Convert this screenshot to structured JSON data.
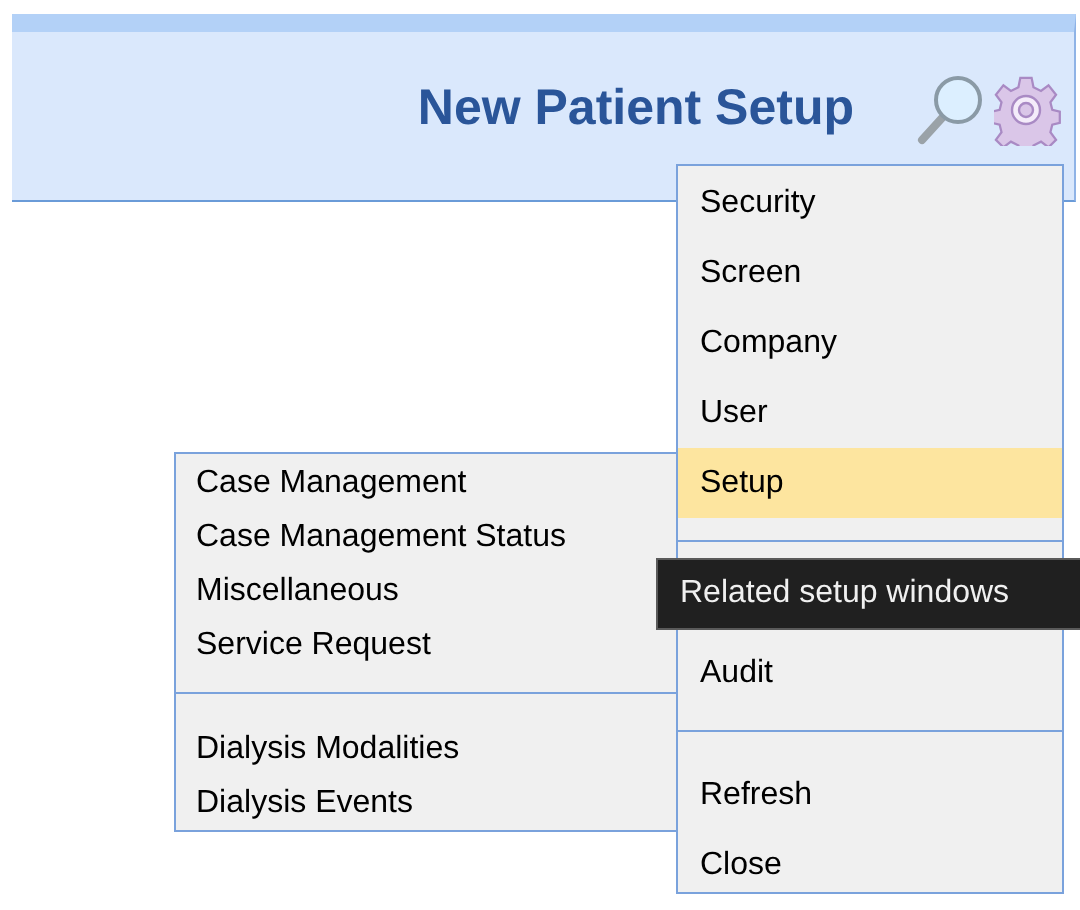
{
  "header": {
    "title": "New Patient Setup"
  },
  "menu": {
    "items": [
      {
        "kind": "item",
        "label": "Security",
        "selected": false
      },
      {
        "kind": "item",
        "label": "Screen",
        "selected": false
      },
      {
        "kind": "item",
        "label": "Company",
        "selected": false
      },
      {
        "kind": "item",
        "label": "User",
        "selected": false
      },
      {
        "kind": "item",
        "label": "Setup",
        "selected": true
      },
      {
        "kind": "separator"
      },
      {
        "kind": "tooltip",
        "text": "Related setup windows"
      },
      {
        "kind": "item",
        "label": "Audit",
        "selected": false
      },
      {
        "kind": "separator"
      },
      {
        "kind": "item",
        "label": "Refresh",
        "selected": false
      },
      {
        "kind": "item",
        "label": "Close",
        "selected": false
      }
    ]
  },
  "submenu": {
    "items": [
      {
        "kind": "item",
        "label": "Case Management"
      },
      {
        "kind": "item",
        "label": "Case Management Status"
      },
      {
        "kind": "item",
        "label": "Miscellaneous"
      },
      {
        "kind": "item",
        "label": "Service Request"
      },
      {
        "kind": "separator"
      },
      {
        "kind": "item",
        "label": "Dialysis Modalities"
      },
      {
        "kind": "item",
        "label": "Dialysis Events"
      }
    ]
  }
}
